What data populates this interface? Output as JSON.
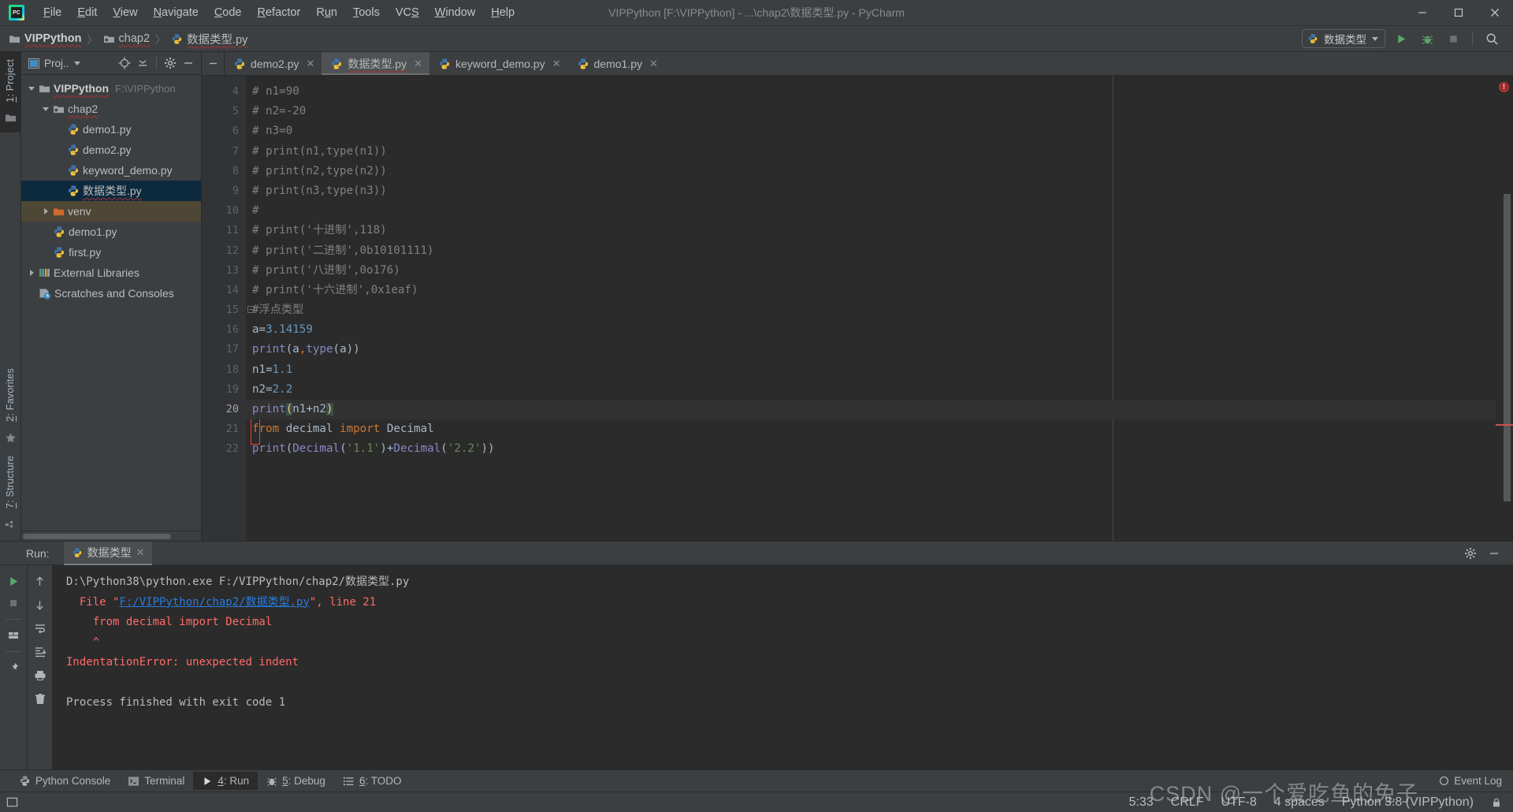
{
  "window": {
    "title": "VIPPython [F:\\VIPPython] - ...\\chap2\\数据类型.py - PyCharm",
    "minimize": "—",
    "maximize": "▢",
    "close": "✕"
  },
  "menubar": {
    "items": [
      {
        "label": "File",
        "mnemonic": "F"
      },
      {
        "label": "Edit",
        "mnemonic": "E"
      },
      {
        "label": "View",
        "mnemonic": "V"
      },
      {
        "label": "Navigate",
        "mnemonic": "N"
      },
      {
        "label": "Code",
        "mnemonic": "C"
      },
      {
        "label": "Refactor",
        "mnemonic": "R"
      },
      {
        "label": "Run",
        "mnemonic": "u"
      },
      {
        "label": "Tools",
        "mnemonic": "T"
      },
      {
        "label": "VCS",
        "mnemonic": "S"
      },
      {
        "label": "Window",
        "mnemonic": "W"
      },
      {
        "label": "Help",
        "mnemonic": "H"
      }
    ]
  },
  "breadcrumb": {
    "items": [
      "VIPPython",
      "chap2",
      "数据类型.py"
    ],
    "separator": "〉"
  },
  "toolbar": {
    "run_config_name": "数据类型",
    "run_label": "Run",
    "debug_label": "Debug",
    "stop_label": "Stop",
    "search_label": "Search Everywhere"
  },
  "left_strip": {
    "project_tab": "1: Project",
    "favorites_tab": "2: Favorites",
    "structure_tab": "7: Structure"
  },
  "project_panel": {
    "title": "Proj..",
    "tree": [
      {
        "indent": 0,
        "arrow": "down",
        "icon": "folder-icon",
        "label": "VIPPython",
        "bold": true,
        "path": "F:\\VIPPython",
        "state": "normal",
        "squiggle": true
      },
      {
        "indent": 1,
        "arrow": "down",
        "icon": "module-folder-icon",
        "label": "chap2",
        "bold": false,
        "path": "",
        "state": "normal",
        "squiggle": true
      },
      {
        "indent": 2,
        "arrow": "none",
        "icon": "python-file-icon",
        "label": "demo1.py",
        "bold": false,
        "path": "",
        "state": "normal",
        "squiggle": false
      },
      {
        "indent": 2,
        "arrow": "none",
        "icon": "python-file-icon",
        "label": "demo2.py",
        "bold": false,
        "path": "",
        "state": "normal",
        "squiggle": false
      },
      {
        "indent": 2,
        "arrow": "none",
        "icon": "python-file-icon",
        "label": "keyword_demo.py",
        "bold": false,
        "path": "",
        "state": "normal",
        "squiggle": false
      },
      {
        "indent": 2,
        "arrow": "none",
        "icon": "python-file-icon",
        "label": "数据类型.py",
        "bold": false,
        "path": "",
        "state": "selected",
        "squiggle": true
      },
      {
        "indent": 1,
        "arrow": "right",
        "icon": "venv-folder-icon",
        "label": "venv",
        "bold": false,
        "path": "",
        "state": "venv",
        "squiggle": false
      },
      {
        "indent": 1,
        "arrow": "none",
        "icon": "python-file-icon",
        "label": "demo1.py",
        "bold": false,
        "path": "",
        "state": "normal",
        "squiggle": false
      },
      {
        "indent": 1,
        "arrow": "none",
        "icon": "python-file-icon",
        "label": "first.py",
        "bold": false,
        "path": "",
        "state": "normal",
        "squiggle": false
      },
      {
        "indent": 0,
        "arrow": "right",
        "icon": "libraries-icon",
        "label": "External Libraries",
        "bold": false,
        "path": "",
        "state": "normal",
        "squiggle": false
      },
      {
        "indent": 0,
        "arrow": "none",
        "icon": "scratches-icon",
        "label": "Scratches and Consoles",
        "bold": false,
        "path": "",
        "state": "normal",
        "squiggle": false
      }
    ]
  },
  "editor": {
    "tabs": [
      {
        "label": "demo2.py",
        "active": false
      },
      {
        "label": "数据类型.py",
        "active": true
      },
      {
        "label": "keyword_demo.py",
        "active": false
      },
      {
        "label": "demo1.py",
        "active": false
      }
    ],
    "close_glyph": "✕",
    "first_line_number": 4,
    "lines": [
      {
        "num": 4,
        "tokens": [
          {
            "t": "comment",
            "v": "# n1=90"
          }
        ]
      },
      {
        "num": 5,
        "tokens": [
          {
            "t": "comment",
            "v": "# n2=-20"
          }
        ]
      },
      {
        "num": 6,
        "tokens": [
          {
            "t": "comment",
            "v": "# n3=0"
          }
        ]
      },
      {
        "num": 7,
        "tokens": [
          {
            "t": "comment",
            "v": "# print(n1,type(n1))"
          }
        ]
      },
      {
        "num": 8,
        "tokens": [
          {
            "t": "comment",
            "v": "# print(n2,type(n2))"
          }
        ]
      },
      {
        "num": 9,
        "tokens": [
          {
            "t": "comment",
            "v": "# print(n3,type(n3))"
          }
        ]
      },
      {
        "num": 10,
        "tokens": [
          {
            "t": "comment",
            "v": "#"
          }
        ]
      },
      {
        "num": 11,
        "tokens": [
          {
            "t": "comment",
            "v": "# print('十进制',118)"
          }
        ]
      },
      {
        "num": 12,
        "tokens": [
          {
            "t": "comment",
            "v": "# print('二进制',0b10101111)"
          }
        ]
      },
      {
        "num": 13,
        "tokens": [
          {
            "t": "comment",
            "v": "# print('八进制',0o176)"
          }
        ]
      },
      {
        "num": 14,
        "tokens": [
          {
            "t": "comment",
            "v": "# print('十六进制',0x1eaf)"
          }
        ]
      },
      {
        "num": 15,
        "fold": true,
        "tokens": [
          {
            "t": "comment",
            "v": "#浮点类型"
          }
        ]
      },
      {
        "num": 16,
        "tokens": [
          {
            "t": "plain",
            "v": "a="
          },
          {
            "t": "num",
            "v": "3.14159"
          }
        ]
      },
      {
        "num": 17,
        "tokens": [
          {
            "t": "fn",
            "v": "print"
          },
          {
            "t": "plain",
            "v": "(a"
          },
          {
            "t": "comma",
            "v": ","
          },
          {
            "t": "fn",
            "v": "type"
          },
          {
            "t": "plain",
            "v": "(a))"
          }
        ]
      },
      {
        "num": 18,
        "tokens": [
          {
            "t": "plain",
            "v": "n1="
          },
          {
            "t": "num",
            "v": "1.1"
          }
        ]
      },
      {
        "num": 19,
        "tokens": [
          {
            "t": "plain",
            "v": "n2="
          },
          {
            "t": "num",
            "v": "2.2"
          }
        ]
      },
      {
        "num": 20,
        "current": true,
        "tokens": [
          {
            "t": "fn",
            "v": "print"
          },
          {
            "t": "parenhl",
            "v": "("
          },
          {
            "t": "plain",
            "v": "n1+n2"
          },
          {
            "t": "parenhl",
            "v": ")"
          }
        ]
      },
      {
        "num": 21,
        "tokens": [
          {
            "t": "kw",
            "v": "from"
          },
          {
            "t": "plain",
            "v": " decimal "
          },
          {
            "t": "kw",
            "v": "import"
          },
          {
            "t": "plain",
            "v": " Decimal"
          }
        ]
      },
      {
        "num": 22,
        "tokens": [
          {
            "t": "fn",
            "v": "print"
          },
          {
            "t": "plain",
            "v": "("
          },
          {
            "t": "fn",
            "v": "Decimal"
          },
          {
            "t": "plain",
            "v": "("
          },
          {
            "t": "str",
            "v": "'1.1'"
          },
          {
            "t": "plain",
            "v": ")+"
          },
          {
            "t": "fn",
            "v": "Decimal"
          },
          {
            "t": "plain",
            "v": "("
          },
          {
            "t": "str",
            "v": "'2.2'"
          },
          {
            "t": "plain",
            "v": "))"
          }
        ]
      }
    ],
    "error_marker_tooltip": "1 error"
  },
  "run_panel": {
    "label": "Run:",
    "tab_title": "数据类型",
    "close_glyph": "✕",
    "console_lines": [
      [
        {
          "c": "gray",
          "v": "D:\\Python38\\python.exe F:/VIPPython/chap2/数据类型.py"
        }
      ],
      [
        {
          "c": "gray",
          "v": "  "
        },
        {
          "c": "red",
          "v": "File \""
        },
        {
          "c": "link",
          "v": "F:/VIPPython/chap2/数据类型.py"
        },
        {
          "c": "red",
          "v": "\", line 21"
        }
      ],
      [
        {
          "c": "gray",
          "v": "    "
        },
        {
          "c": "red",
          "v": "from decimal import Decimal"
        }
      ],
      [
        {
          "c": "gray",
          "v": "    "
        },
        {
          "c": "red",
          "v": "^"
        }
      ],
      [
        {
          "c": "red",
          "v": "IndentationError: unexpected indent"
        }
      ],
      [
        {
          "c": "gray",
          "v": ""
        }
      ],
      [
        {
          "c": "gray",
          "v": "Process finished with exit code 1"
        }
      ]
    ],
    "tools": {
      "rerun": "Rerun",
      "stop": "Stop",
      "layout": "Layout",
      "pin": "Pin Tab",
      "up": "Up",
      "down": "Down",
      "soft_wrap": "Soft-Wrap",
      "scroll_end": "Scroll to End",
      "print": "Print",
      "clear": "Clear All"
    }
  },
  "statusbar": {
    "tools": [
      {
        "label": "Python Console",
        "icon": "python-icon",
        "mnemonic": "",
        "active": false
      },
      {
        "label": "Terminal",
        "icon": "terminal-icon",
        "mnemonic": "",
        "active": false
      },
      {
        "label": "4: Run",
        "icon": "run-icon",
        "mnemonic": "4",
        "active": true
      },
      {
        "label": "5: Debug",
        "icon": "debug-icon",
        "mnemonic": "5",
        "active": false
      },
      {
        "label": "6: TODO",
        "icon": "todo-icon",
        "mnemonic": "6",
        "active": false
      }
    ],
    "event_log": "Event Log",
    "caret_position": "5:33",
    "line_separator": "CRLF",
    "encoding": "UTF-8",
    "indent": "4 spaces",
    "interpreter": "Python 3.8 (VIPPython)"
  },
  "watermark": "CSDN @一个爱吃鱼的兔子"
}
